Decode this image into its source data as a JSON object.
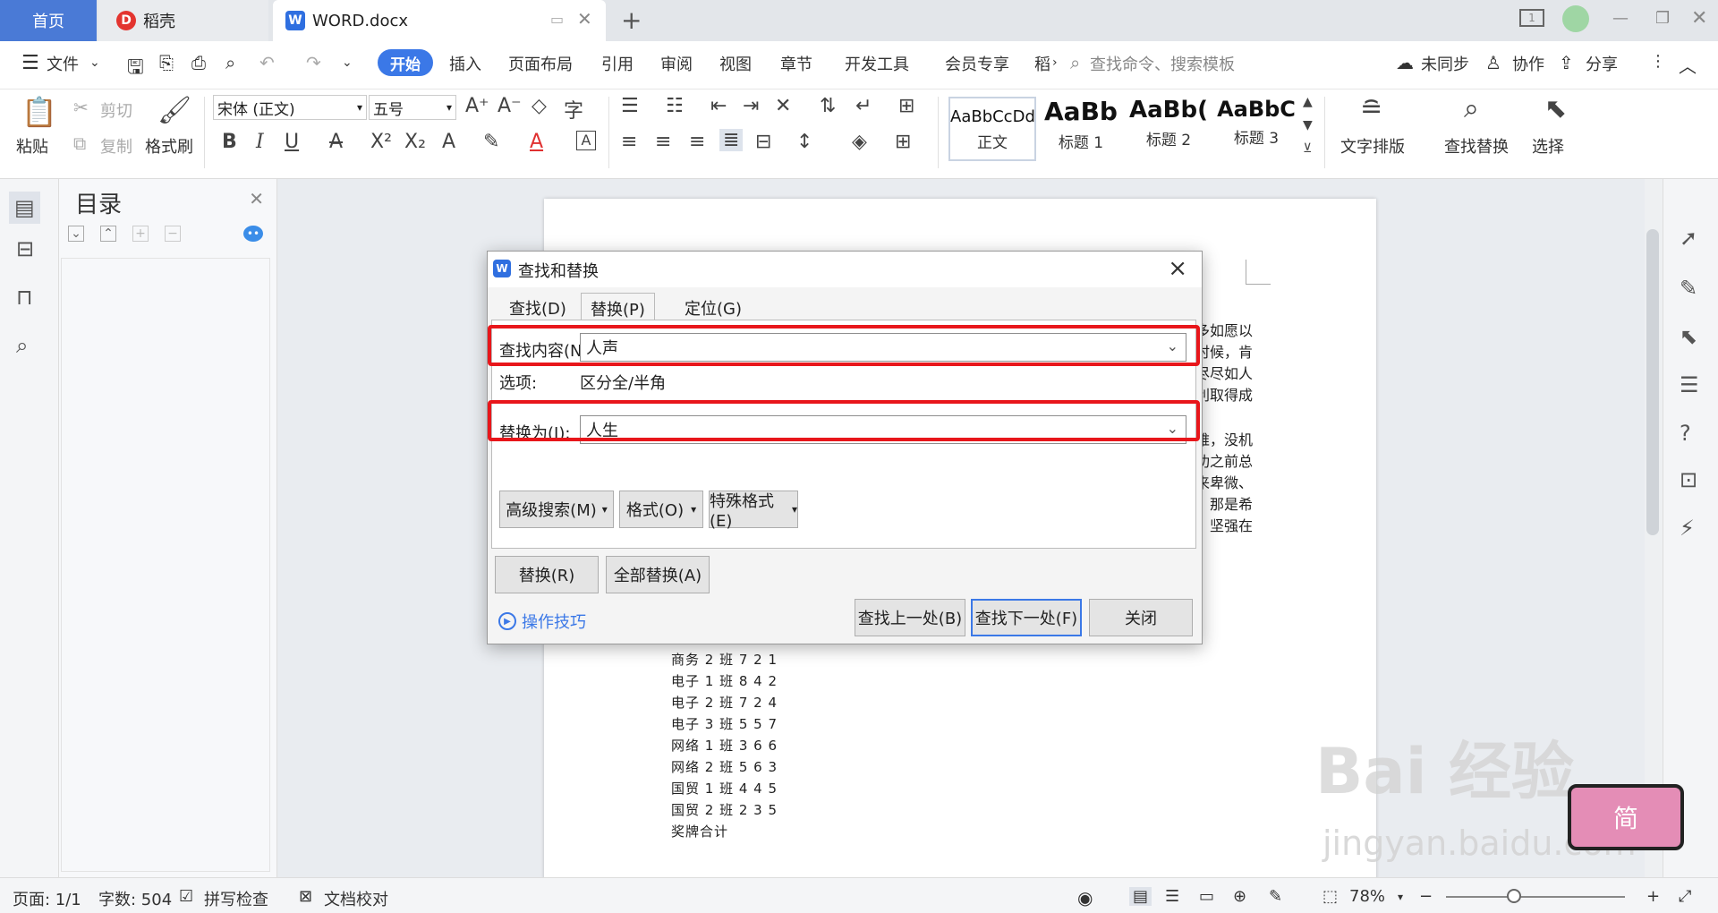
{
  "tabs": {
    "home": "首页",
    "daoke": "稻壳",
    "doc": "WORD.docx",
    "new_tab": "+"
  },
  "menu": {
    "file": "文件",
    "start": "开始",
    "insert": "插入",
    "layout": "页面布局",
    "reference": "引用",
    "review": "审阅",
    "view": "视图",
    "chapter": "章节",
    "developer": "开发工具",
    "member": "会员专享",
    "more": "稻",
    "search_placeholder": "查找命令、搜索模板",
    "sync": "未同步",
    "collab": "协作",
    "share": "分享"
  },
  "ribbon": {
    "paste": "粘贴",
    "cut": "剪切",
    "copy": "复制",
    "format_painter": "格式刷",
    "font_name": "宋体 (正文)",
    "font_size": "五号",
    "styles": [
      {
        "sample": "AaBbCcDd",
        "name": "正文"
      },
      {
        "sample": "AaBb",
        "name": "标题 1"
      },
      {
        "sample": "AaBb(",
        "name": "标题 2"
      },
      {
        "sample": "AaBbC",
        "name": "标题 3"
      }
    ],
    "text_layout": "文字排版",
    "find_replace": "查找替换",
    "select": "选择"
  },
  "toc": {
    "title": "目录"
  },
  "document": {
    "right_fragments": [
      "多如愿以",
      "时候，肯",
      "尽尽如人",
      "利取得成",
      "难，没机",
      "功之前总",
      "来卑微、",
      "，那是希",
      "，坚强在"
    ],
    "rows": [
      "商务 2 班  7 2 1",
      "电子 1 班  8 4 2",
      "电子 2 班  7 2 4",
      "电子 3 班  5 5 7",
      "网络 1 班  3 6 6",
      "网络 2 班  5 6 3",
      "国贸 1 班  4 4 5",
      "国贸 2 班  2 3 5",
      "奖牌合计"
    ]
  },
  "dialog": {
    "title": "查找和替换",
    "tabs": [
      "查找(D)",
      "替换(P)",
      "定位(G)"
    ],
    "find_label": "查找内容(N):",
    "find_value": "人声",
    "options_label": "选项:",
    "options_value": "区分全/半角",
    "replace_label": "替换为(I):",
    "replace_value": "人生",
    "btn_advanced": "高级搜索(M)",
    "btn_format": "格式(O)",
    "btn_special": "特殊格式(E)",
    "btn_replace": "替换(R)",
    "btn_replace_all": "全部替换(A)",
    "tips": "操作技巧",
    "btn_find_prev": "查找上一处(B)",
    "btn_find_next": "查找下一处(F)",
    "btn_close": "关闭"
  },
  "status": {
    "page": "页面: 1/1",
    "word_count": "字数: 504",
    "spell_check": "拼写检查",
    "proof": "文档校对",
    "zoom": "78%"
  },
  "watermark": {
    "logo": "Bai 经验",
    "url": "jingyan.baidu.com",
    "badge": "简"
  }
}
